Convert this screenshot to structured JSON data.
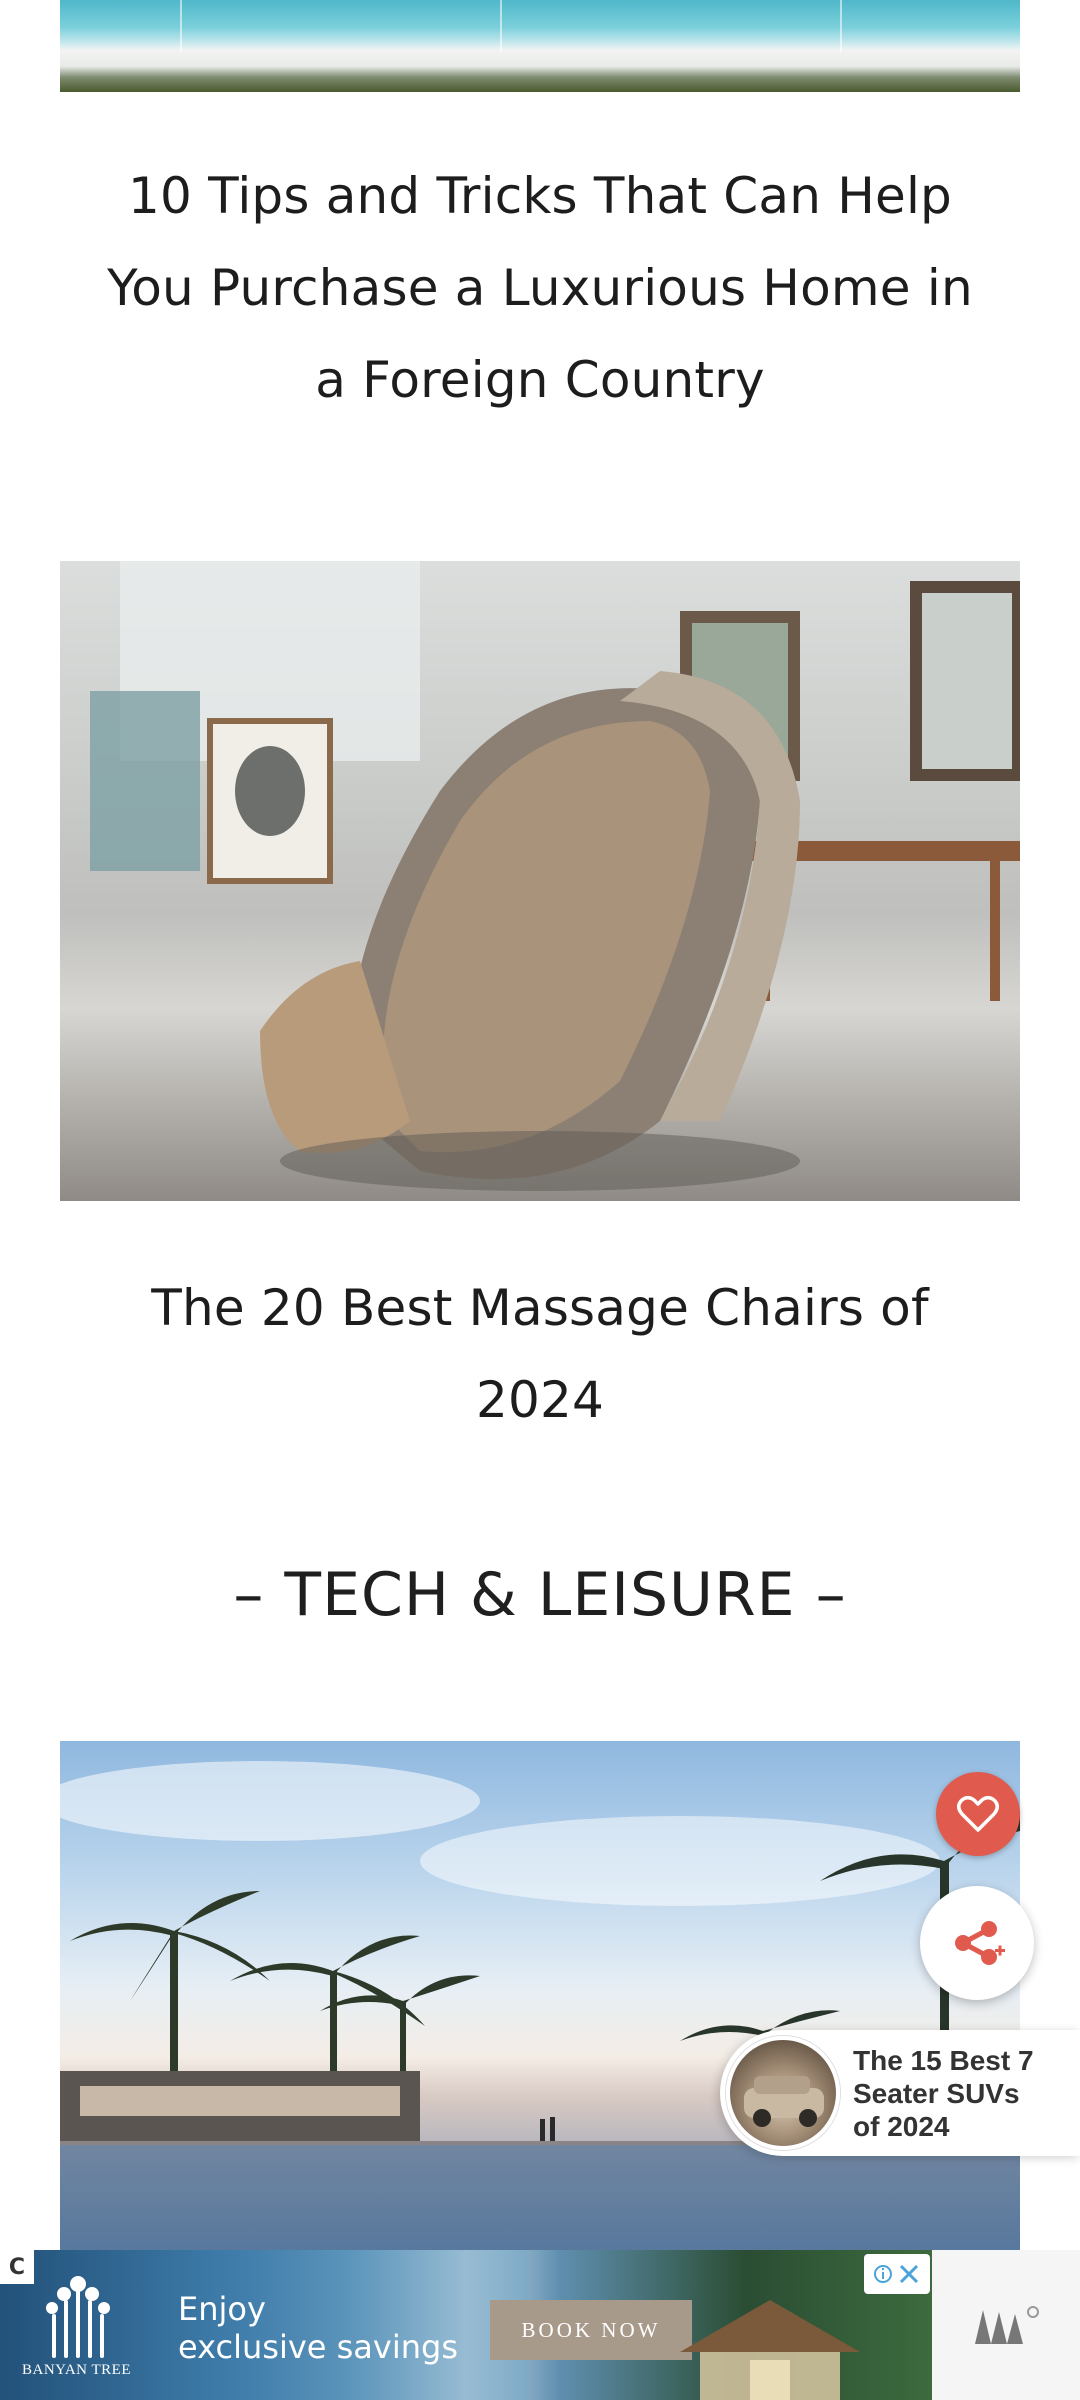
{
  "articles": [
    {
      "title": "10 Tips and Tricks That Can Help You Purchase a Luxurious Home in a Foreign Country",
      "title_lines": [
        "10 Tips and Tricks That Can Help",
        "You Purchase a Luxurious Home in",
        "a Foreign Country"
      ]
    },
    {
      "title": "The 20 Best Massage Chairs of 2024",
      "title_lines": [
        "The 20 Best Massage Chairs of",
        "2024"
      ]
    }
  ],
  "section": {
    "title": "– TECH & LEISURE –"
  },
  "floating": {
    "heart_icon": "heart-icon",
    "share_icon": "share-icon",
    "recommended": {
      "title": "The 15 Best 7 Seater SUVs of 2024",
      "lines": [
        "The 15 Best 7",
        "Seater SUVs",
        "of 2024"
      ]
    }
  },
  "ad": {
    "brand": "BANYAN TREE",
    "copy_lines": [
      "Enjoy",
      "exclusive savings"
    ],
    "cta": "BOOK NOW",
    "corner_mark": "C"
  },
  "colors": {
    "heart_button": "#e05b4d",
    "share_icon": "#e05b4d",
    "text": "#1d1d1d"
  }
}
